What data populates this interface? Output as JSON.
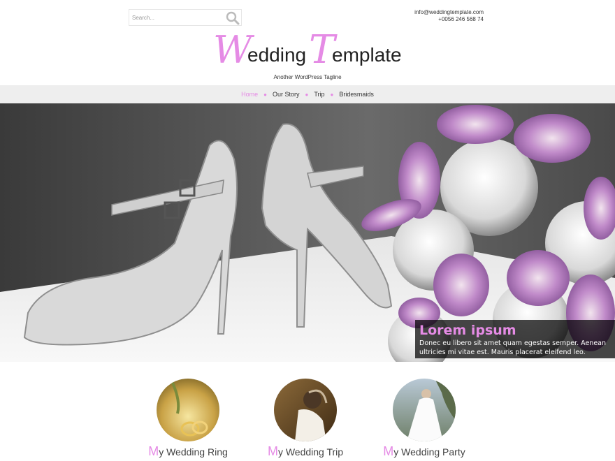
{
  "search": {
    "placeholder": "Search..."
  },
  "contact": {
    "email": "info@weddingtemplate.com",
    "phone": "+0056 246 568 74"
  },
  "logo": {
    "first_letter": "W",
    "part1": "edding",
    "second_letter": "T",
    "part2": "emplate"
  },
  "tagline": "Another WordPress Tagline",
  "nav": [
    {
      "label": "Home",
      "active": true
    },
    {
      "label": "Our Story"
    },
    {
      "label": "Trip"
    },
    {
      "label": "Bridesmaids"
    }
  ],
  "slider": {
    "title": "Lorem ipsum",
    "text": "Donec eu libero sit amet quam egestas semper. Aenean ultricies mi vitae est. Mauris placerat eleifend leo."
  },
  "features": [
    {
      "first": "M",
      "rest": "y Wedding Ring"
    },
    {
      "first": "M",
      "rest": "y Wedding Trip"
    },
    {
      "first": "M",
      "rest": "y Wedding Party"
    }
  ],
  "colors": {
    "accent": "#e58be5",
    "nav_bg": "#eeeeee"
  }
}
